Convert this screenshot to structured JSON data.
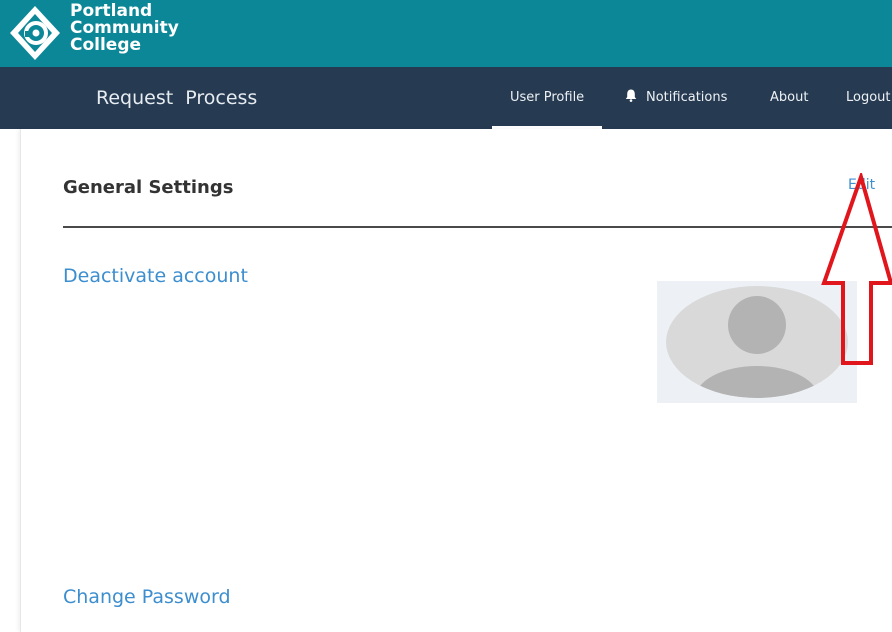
{
  "brand": {
    "line1": "Portland",
    "line2": "Community",
    "line3": "College"
  },
  "nav": {
    "title": "Request  Process",
    "items": [
      {
        "label": "User Profile",
        "icon": ""
      },
      {
        "label": "Notifications",
        "icon": "bell-icon"
      },
      {
        "label": "About",
        "icon": ""
      },
      {
        "label": "Logout",
        "icon": ""
      }
    ]
  },
  "settings": {
    "title": "General Settings",
    "edit_label": "Edit",
    "deactivate_label": "Deactivate account",
    "change_password_label": "Change Password"
  },
  "colors": {
    "brand_teal": "#0c8797",
    "nav_navy": "#263a52",
    "link_blue": "#3c8ecf",
    "annotation_red": "#e0161c"
  }
}
